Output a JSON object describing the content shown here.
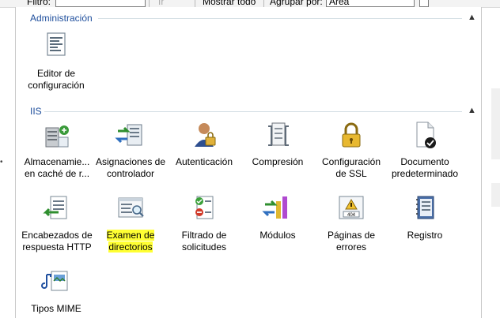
{
  "toolbar": {
    "filter_label": "Filtro:",
    "go_label": "Ir",
    "show_all_label": "Mostrar todo",
    "group_by_label": "Agrupar por:",
    "group_by_value": "Área"
  },
  "groups": {
    "admin": {
      "title": "Administración"
    },
    "iis": {
      "title": "IIS"
    }
  },
  "features": {
    "editor": {
      "line1": "Editor de",
      "line2": "configuración",
      "icon": "config-editor-icon"
    },
    "cache": {
      "line1": "Almacenamie...",
      "line2": "en caché de r...",
      "icon": "output-cache-icon"
    },
    "handler": {
      "line1": "Asignaciones de",
      "line2": "controlador",
      "icon": "handler-mappings-icon"
    },
    "auth": {
      "line1": "Autenticación",
      "line2": "",
      "icon": "authentication-icon"
    },
    "compress": {
      "line1": "Compresión",
      "line2": "",
      "icon": "compression-icon"
    },
    "ssl": {
      "line1": "Configuración",
      "line2": "de SSL",
      "icon": "ssl-lock-icon"
    },
    "default_doc": {
      "line1": "Documento",
      "line2": "predeterminado",
      "icon": "default-document-icon"
    },
    "headers": {
      "line1": "Encabezados de",
      "line2": "respuesta HTTP",
      "icon": "http-headers-icon"
    },
    "dir_browse": {
      "line1": "Examen de",
      "line2": "directorios",
      "icon": "directory-browsing-icon"
    },
    "filtering": {
      "line1": "Filtrado de",
      "line2": "solicitudes",
      "icon": "request-filtering-icon"
    },
    "modules": {
      "line1": "Módulos",
      "line2": "",
      "icon": "modules-icon"
    },
    "errors": {
      "line1": "Páginas de",
      "line2": "errores",
      "icon": "error-pages-icon"
    },
    "logging": {
      "line1": "Registro",
      "line2": "",
      "icon": "logging-icon"
    },
    "mime": {
      "line1": "Tipos MIME",
      "line2": "",
      "icon": "mime-types-icon"
    }
  },
  "colors": {
    "group_title": "#1e4e9c",
    "highlight": "#ffff33"
  }
}
